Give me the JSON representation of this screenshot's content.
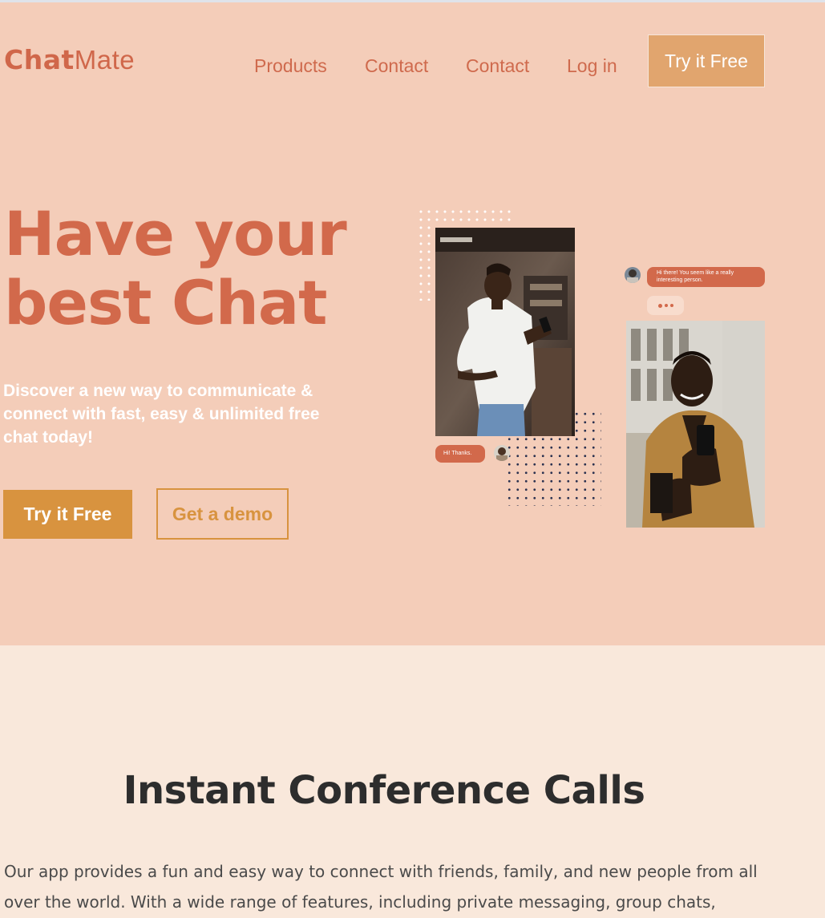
{
  "brand": {
    "name_bold": "Chat",
    "name_light": "Mate"
  },
  "nav": {
    "items": [
      {
        "label": "Products"
      },
      {
        "label": "Contact"
      },
      {
        "label": "Contact"
      },
      {
        "label": "Log in"
      }
    ],
    "cta": "Try it Free"
  },
  "hero": {
    "headline_line1": "Have your",
    "headline_line2": "best Chat",
    "subtext": "Discover a new way to communicate & connect with fast, easy & unlimited free chat today!",
    "primary_button": "Try it Free",
    "secondary_button": "Get a demo",
    "chat_bubble_1": "Hi there! You seem like a really interesting person.",
    "chat_bubble_2": "Hi! Thanks."
  },
  "features": {
    "title": "Instant Conference Calls",
    "paragraph": "Our app provides a fun and easy way to connect with friends, family, and new people from all over the world. With a wide range of features, including private messaging, group chats,"
  },
  "colors": {
    "hero_bg": "#f4cdb9",
    "page_bg": "#f9e8db",
    "accent": "#d2694b",
    "button": "#d8933f"
  },
  "icons": [
    "typing-indicator-icon",
    "avatar"
  ]
}
